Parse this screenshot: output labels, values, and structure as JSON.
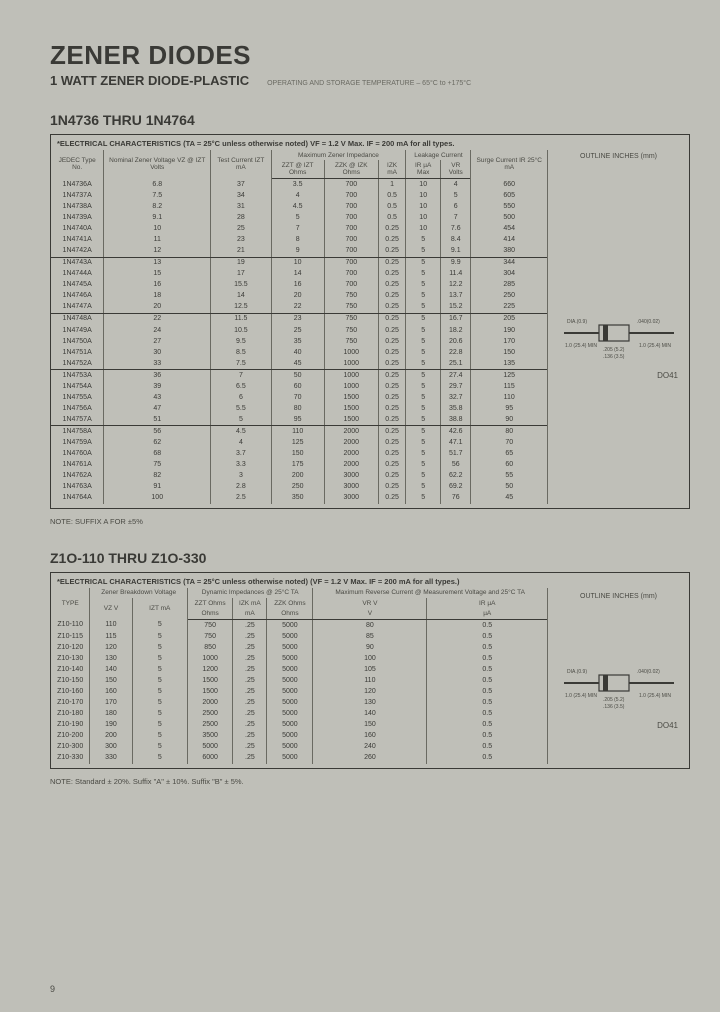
{
  "title": "ZENER DIODES",
  "subtitle": "1 WATT ZENER DIODE-PLASTIC",
  "temp_note": "OPERATING AND STORAGE TEMPERATURE – 65°C to +175°C",
  "section1": {
    "heading": "1N4736 THRU 1N4764",
    "table_title": "*ELECTRICAL CHARACTERISTICS (TA = 25°C unless otherwise noted) VF = 1.2 V Max. IF = 200 mA for all types.",
    "headers": {
      "type": "JEDEC Type No.",
      "vz_group": "Nominal Zener Voltage VZ @ IZT Volts",
      "izt": "Test Current IZT mA",
      "imp_group": "Maximum Zener Impedance",
      "zzt": "ZZT @ IZT Ohms",
      "zzk": "ZZK @ IZK Ohms",
      "izk": "IZK mA",
      "leak_group": "Leakage Current",
      "ir": "IR µA Max",
      "vr": "VR Volts",
      "surge": "Surge Current IR 25°C mA",
      "outline": "OUTLINE INCHES (mm)",
      "package": "DO41"
    },
    "rows": [
      [
        "1N4736A",
        "6.8",
        "37",
        "3.5",
        "700",
        "1",
        "10",
        "4",
        "660"
      ],
      [
        "1N4737A",
        "7.5",
        "34",
        "4",
        "700",
        "0.5",
        "10",
        "5",
        "605"
      ],
      [
        "1N4738A",
        "8.2",
        "31",
        "4.5",
        "700",
        "0.5",
        "10",
        "6",
        "550"
      ],
      [
        "1N4739A",
        "9.1",
        "28",
        "5",
        "700",
        "0.5",
        "10",
        "7",
        "500"
      ],
      [
        "1N4740A",
        "10",
        "25",
        "7",
        "700",
        "0.25",
        "10",
        "7.6",
        "454"
      ],
      [
        "1N4741A",
        "11",
        "23",
        "8",
        "700",
        "0.25",
        "5",
        "8.4",
        "414"
      ],
      [
        "1N4742A",
        "12",
        "21",
        "9",
        "700",
        "0.25",
        "5",
        "9.1",
        "380"
      ],
      [
        "1N4743A",
        "13",
        "19",
        "10",
        "700",
        "0.25",
        "5",
        "9.9",
        "344"
      ],
      [
        "1N4744A",
        "15",
        "17",
        "14",
        "700",
        "0.25",
        "5",
        "11.4",
        "304"
      ],
      [
        "1N4745A",
        "16",
        "15.5",
        "16",
        "700",
        "0.25",
        "5",
        "12.2",
        "285"
      ],
      [
        "1N4746A",
        "18",
        "14",
        "20",
        "750",
        "0.25",
        "5",
        "13.7",
        "250"
      ],
      [
        "1N4747A",
        "20",
        "12.5",
        "22",
        "750",
        "0.25",
        "5",
        "15.2",
        "225"
      ],
      [
        "1N4748A",
        "22",
        "11.5",
        "23",
        "750",
        "0.25",
        "5",
        "16.7",
        "205"
      ],
      [
        "1N4749A",
        "24",
        "10.5",
        "25",
        "750",
        "0.25",
        "5",
        "18.2",
        "190"
      ],
      [
        "1N4750A",
        "27",
        "9.5",
        "35",
        "750",
        "0.25",
        "5",
        "20.6",
        "170"
      ],
      [
        "1N4751A",
        "30",
        "8.5",
        "40",
        "1000",
        "0.25",
        "5",
        "22.8",
        "150"
      ],
      [
        "1N4752A",
        "33",
        "7.5",
        "45",
        "1000",
        "0.25",
        "5",
        "25.1",
        "135"
      ],
      [
        "1N4753A",
        "36",
        "7",
        "50",
        "1000",
        "0.25",
        "5",
        "27.4",
        "125"
      ],
      [
        "1N4754A",
        "39",
        "6.5",
        "60",
        "1000",
        "0.25",
        "5",
        "29.7",
        "115"
      ],
      [
        "1N4755A",
        "43",
        "6",
        "70",
        "1500",
        "0.25",
        "5",
        "32.7",
        "110"
      ],
      [
        "1N4756A",
        "47",
        "5.5",
        "80",
        "1500",
        "0.25",
        "5",
        "35.8",
        "95"
      ],
      [
        "1N4757A",
        "51",
        "5",
        "95",
        "1500",
        "0.25",
        "5",
        "38.8",
        "90"
      ],
      [
        "1N4758A",
        "56",
        "4.5",
        "110",
        "2000",
        "0.25",
        "5",
        "42.6",
        "80"
      ],
      [
        "1N4759A",
        "62",
        "4",
        "125",
        "2000",
        "0.25",
        "5",
        "47.1",
        "70"
      ],
      [
        "1N4760A",
        "68",
        "3.7",
        "150",
        "2000",
        "0.25",
        "5",
        "51.7",
        "65"
      ],
      [
        "1N4761A",
        "75",
        "3.3",
        "175",
        "2000",
        "0.25",
        "5",
        "56",
        "60"
      ],
      [
        "1N4762A",
        "82",
        "3",
        "200",
        "3000",
        "0.25",
        "5",
        "62.2",
        "55"
      ],
      [
        "1N4763A",
        "91",
        "2.8",
        "250",
        "3000",
        "0.25",
        "5",
        "69.2",
        "50"
      ],
      [
        "1N4764A",
        "100",
        "2.5",
        "350",
        "3000",
        "0.25",
        "5",
        "76",
        "45"
      ]
    ],
    "note": "NOTE: SUFFIX A FOR ±5%"
  },
  "section2": {
    "heading": "Z1O-110 THRU Z1O-330",
    "table_title": "*ELECTRICAL CHARACTERISTICS (TA = 25°C unless otherwise noted) (VF = 1.2 V Max. IF = 200 mA for all types.)",
    "headers": {
      "type": "TYPE",
      "vz_group": "Zener Breakdown Voltage",
      "vz": "VZ V",
      "izt": "IZT mA",
      "imp_group": "Dynamic Impedances @ 25°C TA",
      "zzt": "ZZT Ohms",
      "izk": "IZK mA",
      "zzk": "ZZK Ohms",
      "rev_group": "Maximum Reverse Current @ Measurement Voltage and 25°C TA",
      "vr": "VR V",
      "ir": "IR µA",
      "outline": "OUTLINE INCHES (mm)",
      "package": "DO41"
    },
    "rows": [
      [
        "Z10-110",
        "110",
        "5",
        "750",
        ".25",
        "5000",
        "80",
        "0.5"
      ],
      [
        "Z10-115",
        "115",
        "5",
        "750",
        ".25",
        "5000",
        "85",
        "0.5"
      ],
      [
        "Z10-120",
        "120",
        "5",
        "850",
        ".25",
        "5000",
        "90",
        "0.5"
      ],
      [
        "Z10-130",
        "130",
        "5",
        "1000",
        ".25",
        "5000",
        "100",
        "0.5"
      ],
      [
        "Z10-140",
        "140",
        "5",
        "1200",
        ".25",
        "5000",
        "105",
        "0.5"
      ],
      [
        "Z10-150",
        "150",
        "5",
        "1500",
        ".25",
        "5000",
        "110",
        "0.5"
      ],
      [
        "Z10-160",
        "160",
        "5",
        "1500",
        ".25",
        "5000",
        "120",
        "0.5"
      ],
      [
        "Z10-170",
        "170",
        "5",
        "2000",
        ".25",
        "5000",
        "130",
        "0.5"
      ],
      [
        "Z10-180",
        "180",
        "5",
        "2500",
        ".25",
        "5000",
        "140",
        "0.5"
      ],
      [
        "Z10-190",
        "190",
        "5",
        "2500",
        ".25",
        "5000",
        "150",
        "0.5"
      ],
      [
        "Z10-200",
        "200",
        "5",
        "3500",
        ".25",
        "5000",
        "160",
        "0.5"
      ],
      [
        "Z10-300",
        "300",
        "5",
        "5000",
        ".25",
        "5000",
        "240",
        "0.5"
      ],
      [
        "Z10-330",
        "330",
        "5",
        "6000",
        ".25",
        "5000",
        "260",
        "0.5"
      ]
    ],
    "note": "NOTE: Standard ± 20%. Suffix \"A\" ± 10%. Suffix \"B\" ± 5%."
  },
  "diode_dims": {
    "lead_min": "1.0 (25.4) MIN",
    "body_len": ".205 (5.2)",
    "body_dia": ".136 (3.5)",
    "dia": "DIA.(0.9)",
    "alt": ".040(0.02)"
  },
  "page_number": "9"
}
